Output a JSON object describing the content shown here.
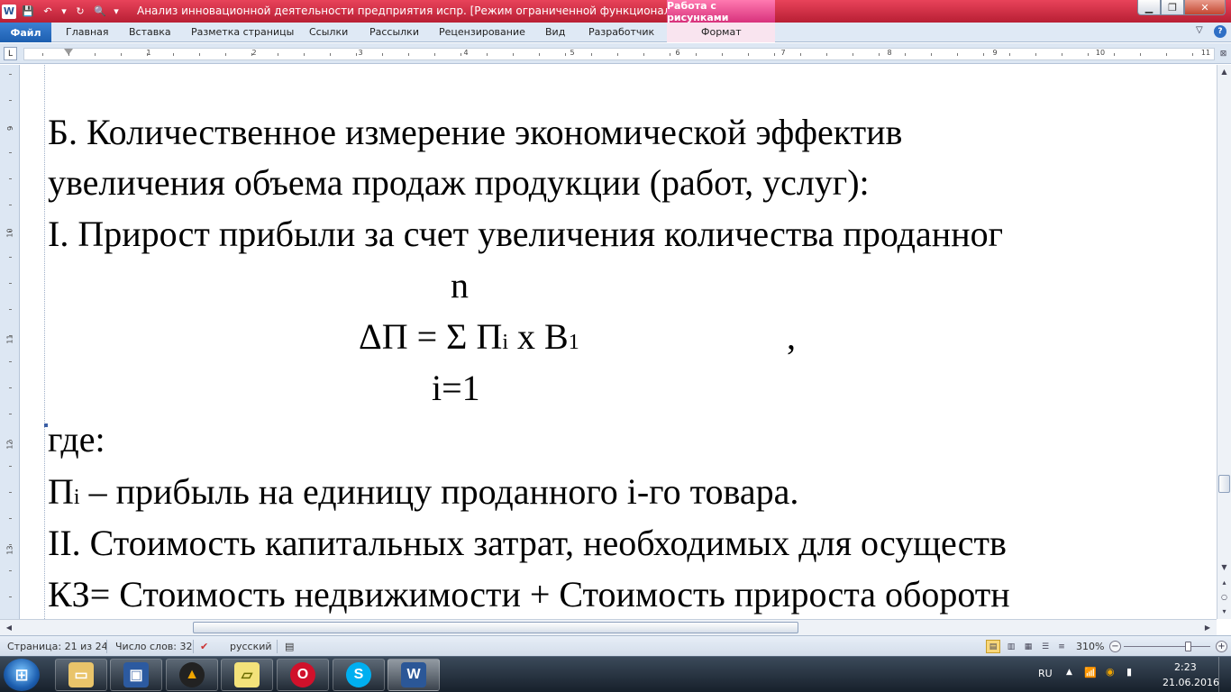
{
  "titlebar": {
    "title": "Анализ инновационной деятельности предприятия испр. [Режим ограниченной функциональности] М.",
    "contextual_group": "Работа с рисунками",
    "app_icon": "word-icon",
    "min_icon": "minimize-icon",
    "max_icon": "maximize-icon",
    "close_icon": "close-icon"
  },
  "ribbon": {
    "file_tab": "Файл",
    "tabs": [
      "Главная",
      "Вставка",
      "Разметка страницы",
      "Ссылки",
      "Рассылки",
      "Рецензирование",
      "Вид",
      "Разработчик",
      "Формат"
    ]
  },
  "ruler": {
    "h_numbers": [
      "1",
      "2",
      "3",
      "4",
      "5",
      "6",
      "7",
      "8",
      "9",
      "10",
      "11"
    ],
    "v_numbers": [
      "9",
      "10",
      "11",
      "12",
      "13"
    ]
  },
  "document": {
    "line1": "Б.  Количественное  измерение  экономической  эффектив",
    "line2": "увеличения объема продаж продукции (работ, услуг):",
    "line3": "I. Прирост прибыли за счет увеличения количества проданног",
    "formula_top": "n",
    "formula_main_a": "ΔП = Σ П",
    "formula_main_sub_i": "i",
    "formula_main_b": " х В",
    "formula_main_sub_1": "1",
    "formula_comma": ",",
    "formula_bottom": "i=1",
    "line_where": "где:",
    "line_def_a": "П",
    "line_def_sub": "i",
    "line_def_b": " – прибыль на единицу проданного i-го товара.",
    "line_ii": "II. Стоимость капитальных затрат, необходимых для осуществ",
    "line_kz": "КЗ= Стоимость недвижимости + Стоимость прироста оборотн"
  },
  "statusbar": {
    "page": "Страница: 21 из 24",
    "words": "Число слов: 32",
    "language": "русский",
    "zoom": "310%"
  },
  "taskbar": {
    "apps": [
      "explorer",
      "save-disk",
      "aimp",
      "sticky-notes",
      "opera",
      "skype",
      "word"
    ],
    "lang": "RU",
    "time": "2:23",
    "date": "21.06.2016"
  },
  "colors": {
    "title_bar": "#c8293f",
    "contextual_tab": "#e8559a",
    "file_tab": "#2a6cc0",
    "ribbon_bg": "#dfe9f5"
  }
}
